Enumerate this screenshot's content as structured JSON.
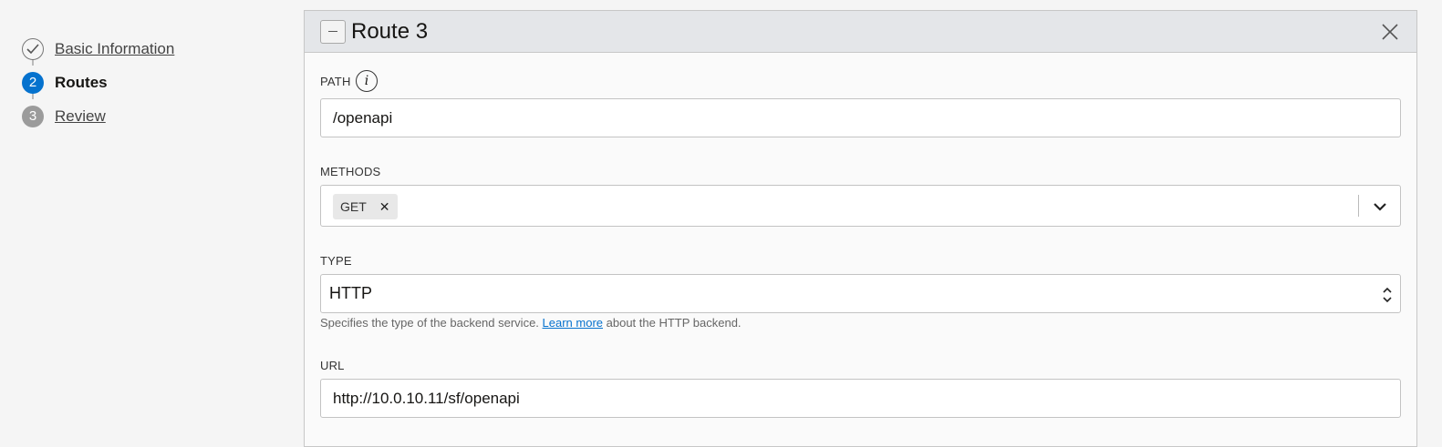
{
  "steps": [
    {
      "number": "",
      "label": "Basic Information",
      "state": "done"
    },
    {
      "number": "2",
      "label": "Routes",
      "state": "current"
    },
    {
      "number": "3",
      "label": "Review",
      "state": "todo"
    }
  ],
  "route": {
    "title": "Route 3",
    "path": {
      "label": "PATH",
      "value": "/openapi"
    },
    "methods": {
      "label": "METHODS",
      "chips": [
        "GET"
      ]
    },
    "type": {
      "label": "TYPE",
      "value": "HTTP",
      "help_before": "Specifies the type of the backend service. ",
      "help_link": "Learn more",
      "help_after": " about the HTTP backend."
    },
    "url": {
      "label": "URL",
      "value": "http://10.0.10.11/sf/openapi"
    }
  },
  "icons": {
    "collapse": "minus-icon",
    "close": "close-icon",
    "info": "info-icon",
    "done": "checkmark-icon",
    "methods_caret": "chevron-down-icon",
    "type_caret": "up-down-caret-icon"
  },
  "colors": {
    "accent": "#0572ce",
    "header_bg": "#e4e6e9",
    "step_todo": "#9b9b9b"
  }
}
